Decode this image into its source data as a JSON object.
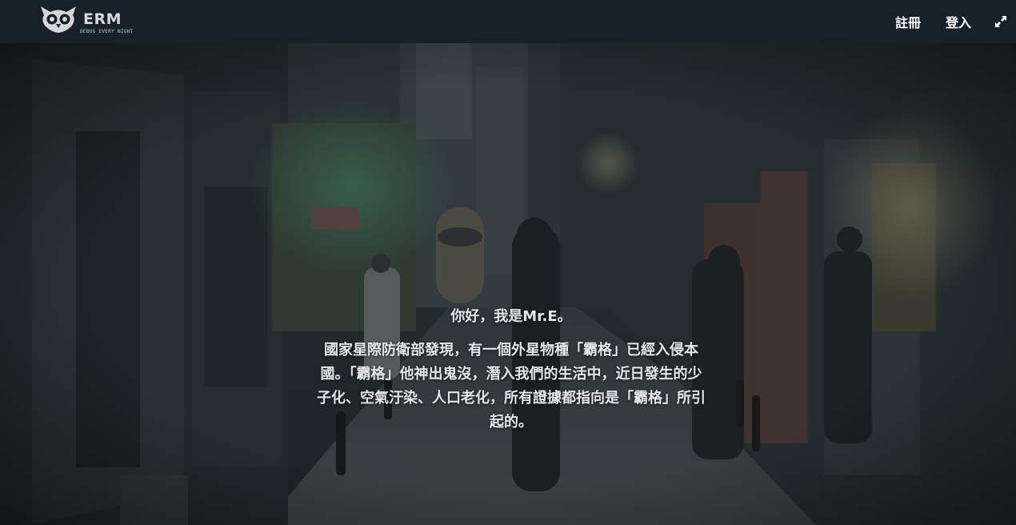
{
  "brand": {
    "name": "ERM",
    "tagline": "DEBUG EVERY NIGHT",
    "logo_icon": "owl-icon"
  },
  "nav": {
    "register_label": "註冊",
    "login_label": "登入",
    "fullscreen_icon": "expand-icon"
  },
  "hero": {
    "greeting": "你好，我是Mr.E。",
    "story": "國家星際防衛部發現，有一個外星物種「霸格」已經入侵本國。「霸格」他神出鬼沒，潛入我們的生活中，近日發生的少子化、空氣汙染、人口老化，所有證據都指向是「霸格」所引起的。"
  },
  "colors": {
    "navbar_bg": "#17212a",
    "text": "#ffffff",
    "hero_overlay": "#1b2226"
  }
}
